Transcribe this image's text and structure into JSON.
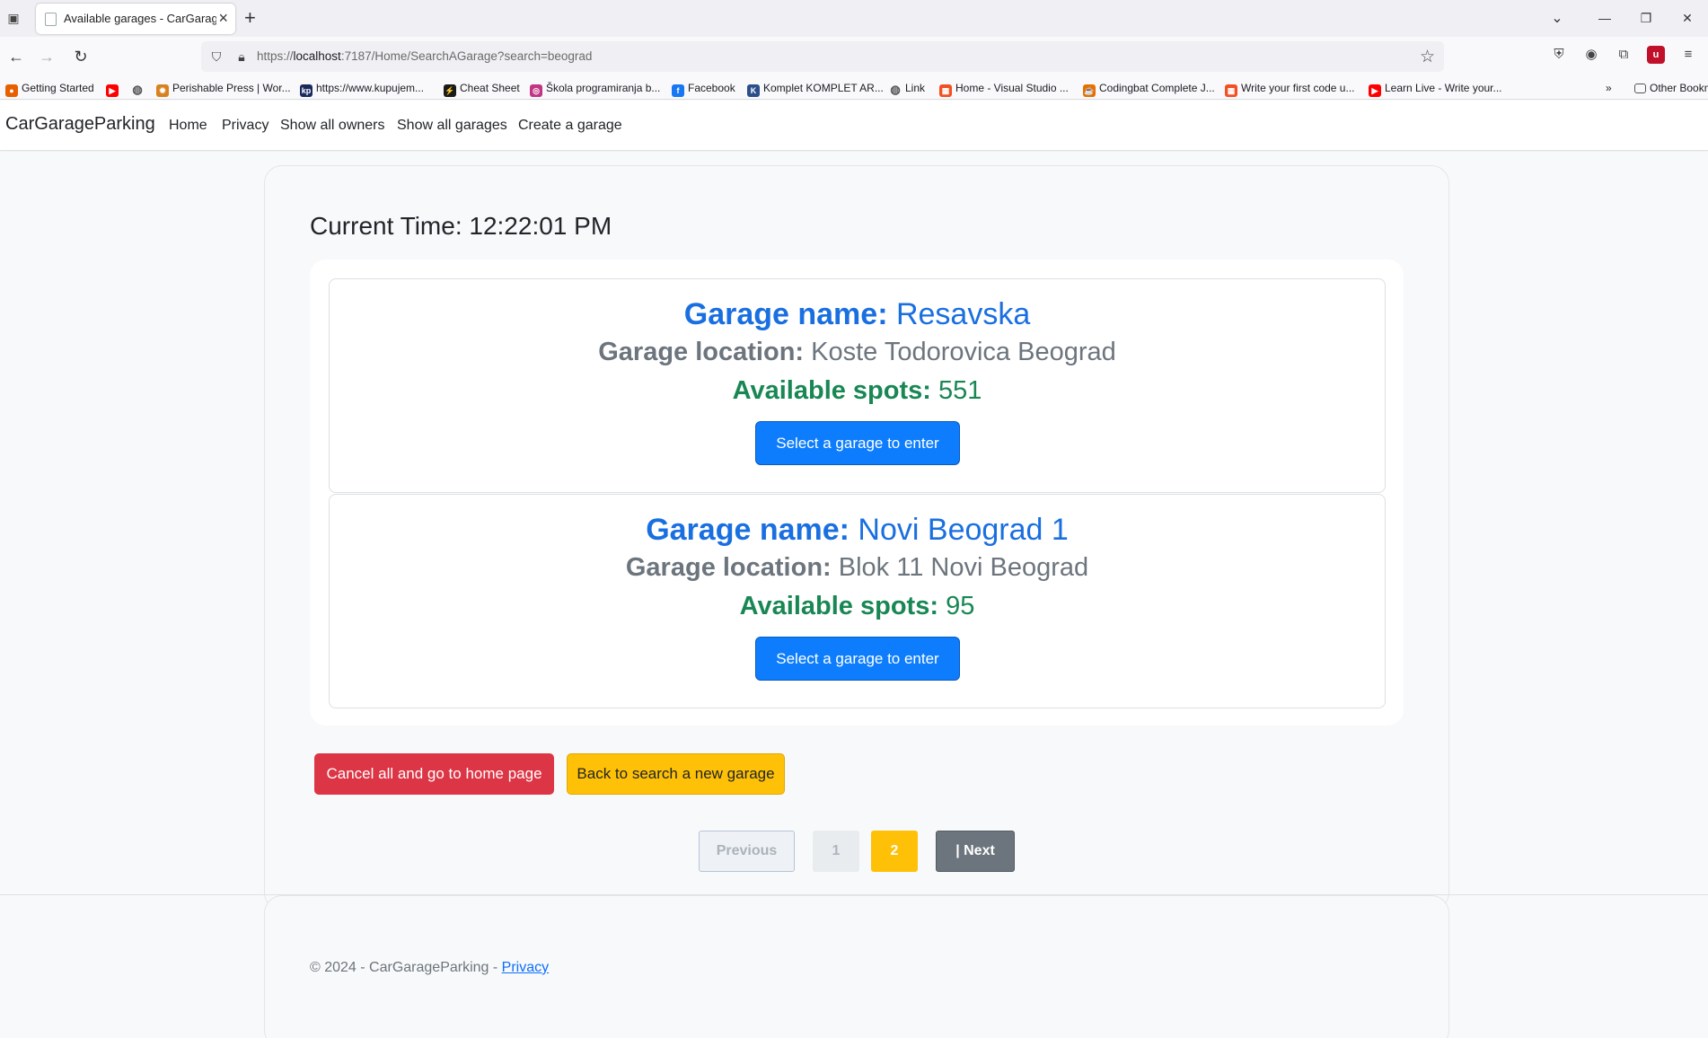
{
  "browser": {
    "tab_title": "Available garages - CarGarageP",
    "url_prefix": "https://",
    "url_host": "localhost",
    "url_rest": ":7187/Home/SearchAGarage?search=beograd",
    "bookmarks": [
      {
        "label": "Getting Started",
        "icon": "firefox-icon",
        "color": "#e66000"
      },
      {
        "label": "",
        "icon": "youtube-icon",
        "color": "#ff0000"
      },
      {
        "label": "",
        "icon": "globe-icon",
        "color": "#555555"
      },
      {
        "label": "Perishable Press | Wor...",
        "icon": "sun-icon",
        "color": "#d8821f"
      },
      {
        "label": "https://www.kupujem...",
        "icon": "kp-icon",
        "color": "#1b2a5e"
      },
      {
        "label": "Cheat Sheet",
        "icon": "bolt-icon",
        "color": "#1a1a1a"
      },
      {
        "label": "Škola programiranja b...",
        "icon": "instagram-icon",
        "color": "#c13584"
      },
      {
        "label": "Facebook",
        "icon": "facebook-icon",
        "color": "#1877f2"
      },
      {
        "label": "Komplet KOMPLET AR...",
        "icon": "k-icon",
        "color": "#2b4f8a"
      },
      {
        "label": "Link",
        "icon": "globe-icon",
        "color": "#555555"
      },
      {
        "label": "Home - Visual Studio ...",
        "icon": "windows-icon",
        "color": "#f25022"
      },
      {
        "label": "Codingbat Complete J...",
        "icon": "java-icon",
        "color": "#e76f00"
      },
      {
        "label": "Write your first code u...",
        "icon": "windows-icon",
        "color": "#f25022"
      },
      {
        "label": "Learn Live - Write your...",
        "icon": "youtube-icon",
        "color": "#ff0000"
      }
    ],
    "other_bookmarks": "Other Bookmarks"
  },
  "site": {
    "brand": "CarGarageParking",
    "nav": [
      "Home",
      "Privacy",
      "Show all owners",
      "Show all garages",
      "Create a garage"
    ]
  },
  "main": {
    "time_label": "Current Time: 12:22:01 PM",
    "garages": [
      {
        "name_label": "Garage name:",
        "name": "Resavska",
        "location_label": "Garage location:",
        "location": "Koste Todorovica Beograd",
        "spots_label": "Available spots:",
        "spots": "551",
        "button": "Select a garage to enter"
      },
      {
        "name_label": "Garage name:",
        "name": "Novi Beograd 1",
        "location_label": "Garage location:",
        "location": "Blok 11 Novi Beograd",
        "spots_label": "Available spots:",
        "spots": "95",
        "button": "Select a garage to enter"
      }
    ],
    "cancel_button": "Cancel all and go to home page",
    "back_button": "Back to search a new garage",
    "pagination": {
      "previous": "Previous",
      "pages": [
        "1",
        "2"
      ],
      "current": "2",
      "next": "| Next"
    }
  },
  "footer": {
    "text": "© 2024 - CarGarageParking - ",
    "privacy_link": "Privacy"
  }
}
